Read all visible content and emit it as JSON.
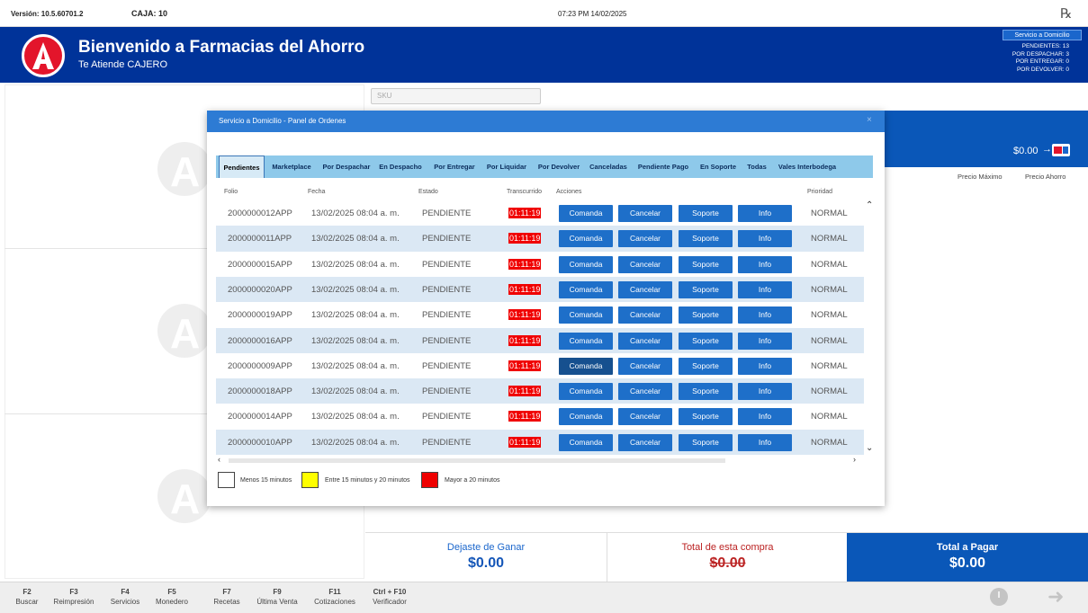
{
  "topbar": {
    "version": "Versión: 10.5.60701.2",
    "caja": "CAJA: 10",
    "datetime": "07:23 PM 14/02/2025",
    "rx_symbol": "℞"
  },
  "header": {
    "title": "Bienvenido a Farmacias del Ahorro",
    "subtitle": "Te Atiende CAJERO",
    "servicio_label": "Servicio a Domicilio",
    "stats": [
      "PENDIENTES: 13",
      "POR DESPACHAR: 3",
      "POR ENTREGAR: 0",
      "POR DEVOLVER: 0"
    ]
  },
  "search": {
    "placeholder": "SKU"
  },
  "right_panel": {
    "total": "$0.00",
    "arrow": "→",
    "precio_maximo": "Precio Máximo",
    "precio_ahorro": "Precio Ahorro"
  },
  "modal": {
    "title": "Servicio a Domicilio - Panel de Ordenes",
    "close": "×",
    "tabs": [
      "Pendientes",
      "Marketplace",
      "Por Despachar",
      "En Despacho",
      "Por Entregar",
      "Por Liquidar",
      "Por Devolver",
      "Canceladas",
      "Pendiente Pago",
      "En Soporte",
      "Todas",
      "Vales Interbodega"
    ],
    "columns": {
      "folio": "Folio",
      "fecha": "Fecha",
      "estado": "Estado",
      "transcurrido": "Transcurrido",
      "acciones": "Acciones",
      "prioridad": "Prioridad"
    },
    "actions": {
      "comanda": "Comanda",
      "cancelar": "Cancelar",
      "soporte": "Soporte",
      "info": "Info"
    },
    "rows": [
      {
        "folio": "2000000012APP",
        "fecha": "13/02/2025 08:04 a. m.",
        "estado": "PENDIENTE",
        "transcurrido": "01:11:19",
        "prioridad": "NORMAL"
      },
      {
        "folio": "2000000011APP",
        "fecha": "13/02/2025 08:04 a. m.",
        "estado": "PENDIENTE",
        "transcurrido": "01:11:19",
        "prioridad": "NORMAL"
      },
      {
        "folio": "2000000015APP",
        "fecha": "13/02/2025 08:04 a. m.",
        "estado": "PENDIENTE",
        "transcurrido": "01:11:19",
        "prioridad": "NORMAL"
      },
      {
        "folio": "2000000020APP",
        "fecha": "13/02/2025 08:04 a. m.",
        "estado": "PENDIENTE",
        "transcurrido": "01:11:19",
        "prioridad": "NORMAL"
      },
      {
        "folio": "2000000019APP",
        "fecha": "13/02/2025 08:04 a. m.",
        "estado": "PENDIENTE",
        "transcurrido": "01:11:19",
        "prioridad": "NORMAL"
      },
      {
        "folio": "2000000016APP",
        "fecha": "13/02/2025 08:04 a. m.",
        "estado": "PENDIENTE",
        "transcurrido": "01:11:19",
        "prioridad": "NORMAL"
      },
      {
        "folio": "2000000009APP",
        "fecha": "13/02/2025 08:04 a. m.",
        "estado": "PENDIENTE",
        "transcurrido": "01:11:19",
        "prioridad": "NORMAL"
      },
      {
        "folio": "2000000018APP",
        "fecha": "13/02/2025 08:04 a. m.",
        "estado": "PENDIENTE",
        "transcurrido": "01:11:19",
        "prioridad": "NORMAL"
      },
      {
        "folio": "2000000014APP",
        "fecha": "13/02/2025 08:04 a. m.",
        "estado": "PENDIENTE",
        "transcurrido": "01:11:19",
        "prioridad": "NORMAL"
      },
      {
        "folio": "2000000010APP",
        "fecha": "13/02/2025 08:04 a. m.",
        "estado": "PENDIENTE",
        "transcurrido": "01:11:19",
        "prioridad": "NORMAL"
      }
    ],
    "legend": {
      "white": "Menos 15 minutos",
      "yellow": "Entre 15 minutos y 20 minutos",
      "red": "Mayor a 20 minutos"
    }
  },
  "totals": {
    "dejaste_label": "Dejaste de Ganar",
    "dejaste_value": "$0.00",
    "compra_label": "Total de esta compra",
    "compra_value": "$0.00",
    "pagar_label": "Total a Pagar",
    "pagar_value": "$0.00"
  },
  "footer": {
    "keys": [
      {
        "key": "F2",
        "label": "Buscar"
      },
      {
        "key": "F3",
        "label": "Reimpresión"
      },
      {
        "key": "F4",
        "label": "Servicios"
      },
      {
        "key": "F5",
        "label": "Monedero"
      },
      {
        "key": "F7",
        "label": "Recetas"
      },
      {
        "key": "F9",
        "label": "Última Venta"
      },
      {
        "key": "F11",
        "label": "Cotizaciones"
      },
      {
        "key": "Ctrl + F10",
        "label": "Verificador"
      }
    ]
  },
  "colors": {
    "header_blue": "#003399",
    "button_blue": "#1e6fc9",
    "timer_red": "#f00000",
    "tabs_bg": "#8ec9ea",
    "brand_red": "#e3152b"
  }
}
